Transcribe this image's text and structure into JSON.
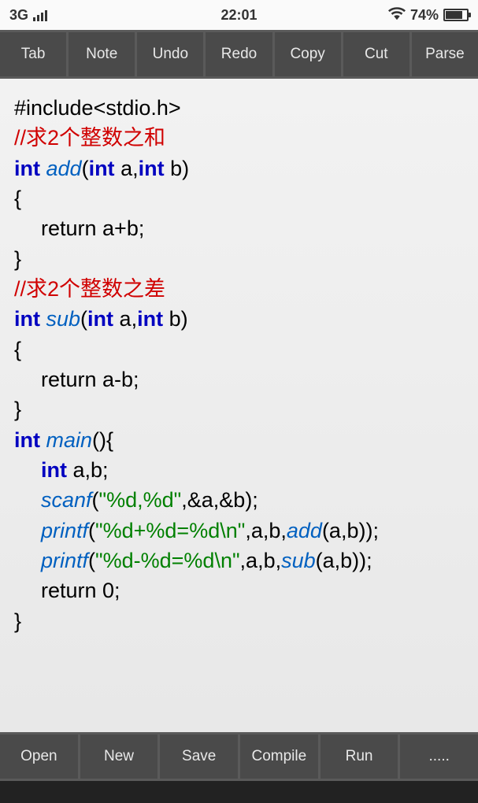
{
  "status": {
    "network": "3G",
    "time": "22:01",
    "battery_pct": "74%"
  },
  "toolbar": {
    "tab": "Tab",
    "note": "Note",
    "undo": "Undo",
    "redo": "Redo",
    "copy": "Copy",
    "cut": "Cut",
    "parse": "Parse"
  },
  "code": {
    "l0": "#include<stdio.h>",
    "l1": "",
    "l2_cmt": "//求2个整数之和",
    "l3_kw1": "int",
    "l3_fn": " add",
    "l3_p1": "(",
    "l3_kw2": "int",
    "l3_p2": " a,",
    "l3_kw3": "int",
    "l3_p3": " b)",
    "l4": "{",
    "l5": "return a+b;",
    "l6": "}",
    "l7_cmt": "//求2个整数之差",
    "l8_kw1": "int",
    "l8_fn": " sub",
    "l8_p1": "(",
    "l8_kw2": "int",
    "l8_p2": " a,",
    "l8_kw3": "int",
    "l8_p3": " b)",
    "l9": "{",
    "l10": "return a-b;",
    "l11": "}",
    "l12": "",
    "l13_kw1": "int",
    "l13_fn": " main",
    "l13_p1": "(){",
    "l14_kw": "int",
    "l14_p": " a,b;",
    "l15_fn": "scanf",
    "l15_p1": "(",
    "l15_str": "\"%d,%d\"",
    "l15_p2": ",&a,&b);",
    "l16_fn": "printf",
    "l16_p1": "(",
    "l16_str": "\"%d+%d=%d\\n\"",
    "l16_p2": ",a,b,",
    "l16_fn2": "add",
    "l16_p3": "(a,b));",
    "l17_fn": "printf",
    "l17_p1": "(",
    "l17_str": "\"%d-%d=%d\\n\"",
    "l17_p2": ",a,b,",
    "l17_fn2": "sub",
    "l17_p3": "(a,b));",
    "l18": "return 0;",
    "l19": "}"
  },
  "bottombar": {
    "open": "Open",
    "new": "New",
    "save": "Save",
    "compile": "Compile",
    "run": "Run",
    "more": "....."
  }
}
